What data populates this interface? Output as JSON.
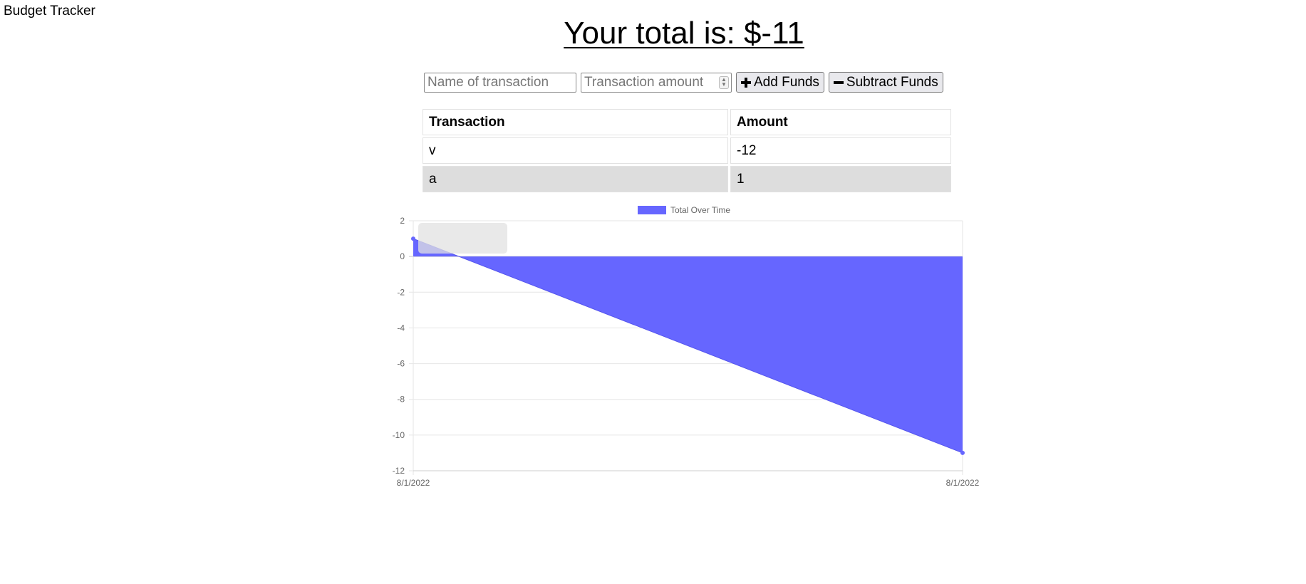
{
  "header": {
    "app_title": "Budget Tracker",
    "total_text": "Your total is: $-11"
  },
  "form": {
    "name_placeholder": "Name of transaction",
    "amount_placeholder": "Transaction amount",
    "add_label": "Add Funds",
    "subtract_label": "Subtract Funds"
  },
  "table": {
    "columns": [
      "Transaction",
      "Amount"
    ],
    "rows": [
      {
        "name": "v",
        "amount": "-12"
      },
      {
        "name": "a",
        "amount": "1"
      }
    ]
  },
  "chart_data": {
    "type": "area",
    "legend": "Total Over Time",
    "x": [
      "8/1/2022",
      "8/1/2022"
    ],
    "series": [
      {
        "name": "Total Over Time",
        "values": [
          1,
          -11
        ]
      }
    ],
    "y_ticks": [
      2,
      0,
      -2,
      -4,
      -6,
      -8,
      -10,
      -12
    ],
    "ylim": [
      -12,
      2
    ],
    "grid": true,
    "legend_position": "top-center",
    "fill_color": "#6666ff"
  }
}
